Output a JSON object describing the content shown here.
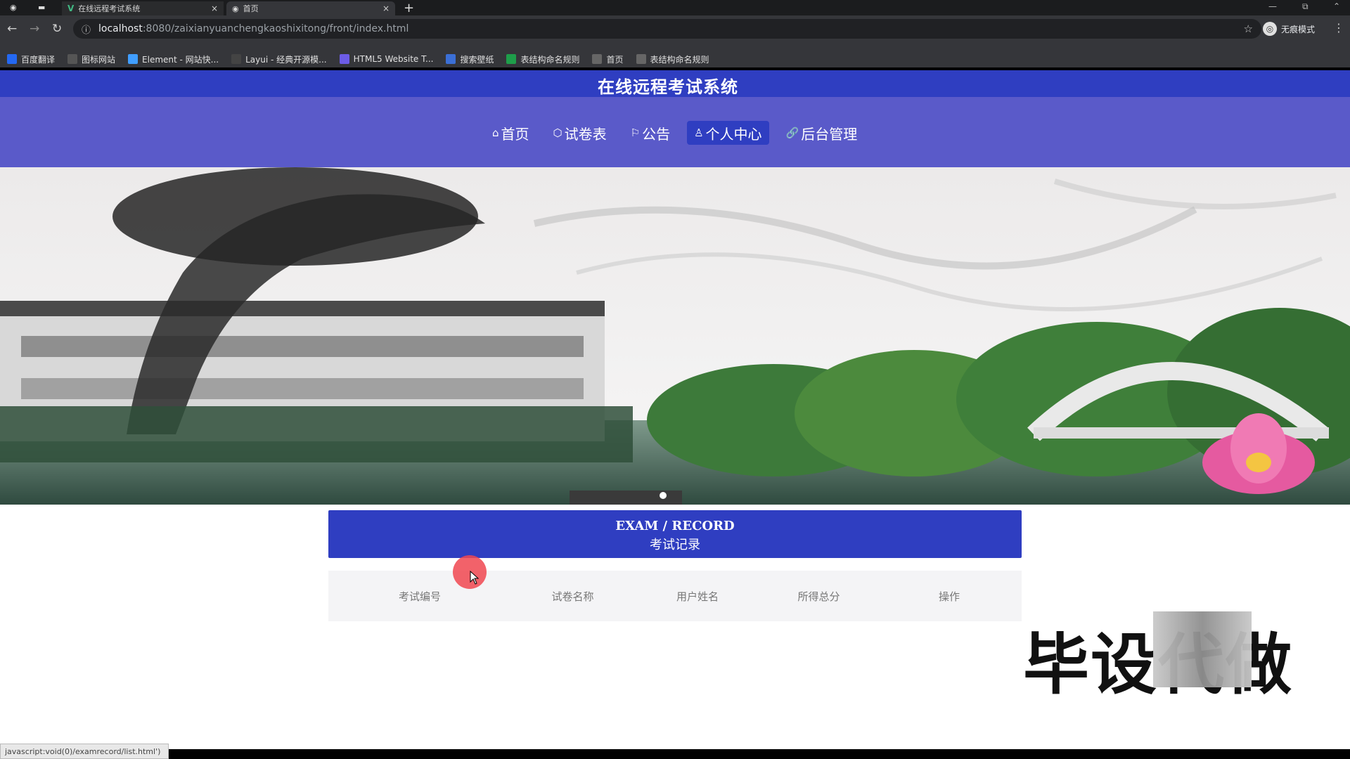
{
  "browser": {
    "tabs": [
      {
        "label": "在线远程考试系统",
        "icon": "vue-logo-icon"
      },
      {
        "label": "首页",
        "icon": "globe-icon"
      }
    ],
    "new_tab": "+",
    "url_host": "localhost",
    "url_rest": ":8080/zaixianyuanchengkaoshixitong/front/index.html",
    "incognito_label": "无痕模式",
    "bookmarks": [
      {
        "label": "百度翻译",
        "icon": "translate-icon",
        "color": "#2468f2"
      },
      {
        "label": "图标网站",
        "icon": "flag-icon",
        "color": "#555555"
      },
      {
        "label": "Element - 网站快...",
        "icon": "element-icon",
        "color": "#409eff"
      },
      {
        "label": "Layui - 经典开源模...",
        "icon": "layui-icon",
        "color": "#444444"
      },
      {
        "label": "HTML5 Website T...",
        "icon": "html5-icon",
        "color": "#6c5ce7"
      },
      {
        "label": "搜索壁纸",
        "icon": "wallpaper-icon",
        "color": "#3b6fd6"
      },
      {
        "label": "表结构命名规则",
        "icon": "sheet-icon",
        "color": "#1e9e4a"
      },
      {
        "label": "首页",
        "icon": "globe-icon",
        "color": "#666666"
      },
      {
        "label": "表结构命名规则",
        "icon": "globe-icon",
        "color": "#666666"
      }
    ]
  },
  "site": {
    "title": "在线远程考试系统",
    "nav": [
      {
        "label": "首页",
        "icon": "home-icon",
        "glyph": "⌂"
      },
      {
        "label": "试卷表",
        "icon": "cube-icon",
        "glyph": "⬡"
      },
      {
        "label": "公告",
        "icon": "flag-icon",
        "glyph": "⚐"
      },
      {
        "label": "个人中心",
        "icon": "user-icon",
        "glyph": "♙",
        "active": true
      },
      {
        "label": "后台管理",
        "icon": "link-icon",
        "glyph": "🔗"
      }
    ],
    "section": {
      "en": "EXAM / RECORD",
      "cn": "考试记录"
    },
    "table_headers": [
      "考试编号",
      "试卷名称",
      "用户姓名",
      "所得总分",
      "操作"
    ]
  },
  "overlay": {
    "watermark": "毕设代做"
  },
  "status_url": "javascript:void(0)/examrecord/list.html')",
  "colors": {
    "header": "#2f3ec1",
    "nav": "#5a5ac9",
    "active_nav": "#2f3ec1"
  }
}
